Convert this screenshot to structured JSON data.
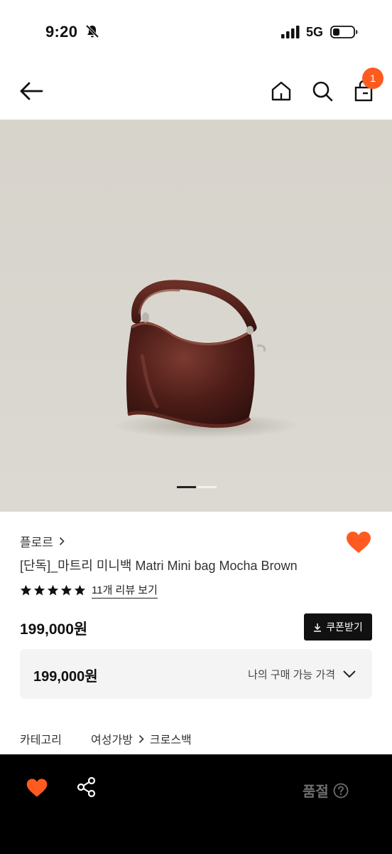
{
  "status_bar": {
    "time": "9:20",
    "network": "5G",
    "icons": [
      "bell-slash-icon",
      "signal-icon",
      "battery-icon"
    ]
  },
  "nav": {
    "icons": [
      "back-arrow-icon",
      "home-icon",
      "search-icon",
      "shopping-bag-icon"
    ],
    "cart_count": "1"
  },
  "hero": {
    "image_subject": "dark brown leather mini handbag",
    "carousel_current": 1
  },
  "product": {
    "brand": "플로르",
    "title": "[단독]_마트리 미니백 Matri Mini bag Mocha Brown",
    "rating_stars": 5,
    "review_link": "11개 리뷰 보기",
    "price": "199,000원",
    "coupon_button": "쿠폰받기",
    "wished": true
  },
  "my_price": {
    "value": "199,000원",
    "label": "나의 구매 가능 가격"
  },
  "category": {
    "key": "카테고리",
    "path": [
      "여성가방",
      "크로스백"
    ]
  },
  "bottom_bar": {
    "status_label": "품절",
    "icons": [
      "heart-icon",
      "share-icon",
      "help-circle-icon"
    ]
  },
  "colors": {
    "accent": "#ff5a1f",
    "bottom_bar_bg": "#000000",
    "hero_bg": "#d8d5ce",
    "bag_brown": "#4a1c16"
  }
}
